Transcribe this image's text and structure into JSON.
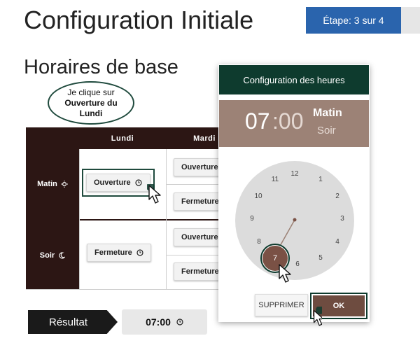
{
  "header": {
    "title": "Configuration Initiale",
    "step_badge": "Étape: 3 sur 4"
  },
  "section": {
    "title": "Horaires de base"
  },
  "callout": {
    "line1": "Je clique sur",
    "line2": "Ouverture du",
    "line3": "Lundi"
  },
  "schedule": {
    "columns": [
      "Lundi",
      "Mardi"
    ],
    "rows": [
      {
        "label": "Matin",
        "icon": "sun-icon"
      },
      {
        "label": "Soir",
        "icon": "moon-icon"
      }
    ],
    "mon_morning": "Ouverture",
    "mon_evening": "Fermeture",
    "tue_morning_open": "Ouverture",
    "tue_morning_close": "Fermeture",
    "tue_evening_open": "Ouverture",
    "tue_evening_close": "Fermeture"
  },
  "dialog": {
    "title": "Configuration des heures",
    "hour": "07",
    "minutes": ":00",
    "period_selected": "Matin",
    "period_other": "Soir",
    "selected_hour": "7",
    "delete_label": "SUPPRIMER",
    "ok_label": "OK"
  },
  "result": {
    "label": "Résultat",
    "value": "07:00"
  },
  "colors": {
    "accent_blue": "#2a64ad",
    "dark_green": "#0e3b2e",
    "dark_brown": "#2c1614",
    "taupe": "#9c8276",
    "brown": "#6e4c40"
  }
}
